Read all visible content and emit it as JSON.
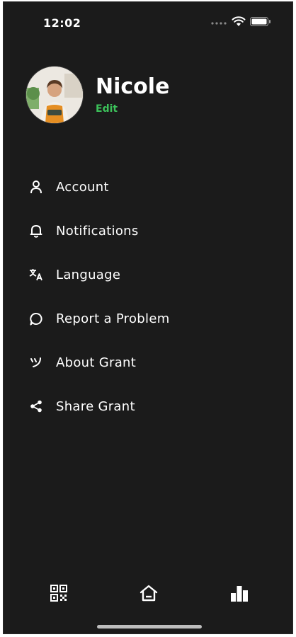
{
  "status_bar": {
    "time": "12:02"
  },
  "profile": {
    "name": "Nicole",
    "edit_label": "Edit"
  },
  "menu": {
    "items": [
      {
        "label": "Account",
        "icon": "person-icon"
      },
      {
        "label": "Notifications",
        "icon": "bell-icon"
      },
      {
        "label": "Language",
        "icon": "translate-icon"
      },
      {
        "label": "Report a Problem",
        "icon": "chat-bubble-icon"
      },
      {
        "label": "About Grant",
        "icon": "grant-logo-icon"
      },
      {
        "label": "Share Grant",
        "icon": "share-icon"
      }
    ]
  },
  "tabbar": {
    "tabs": [
      {
        "icon": "qr-code-icon"
      },
      {
        "icon": "home-icon"
      },
      {
        "icon": "bar-chart-icon"
      }
    ]
  },
  "colors": {
    "background": "#1b1b1b",
    "text": "#ffffff",
    "accent": "#3cc25a"
  }
}
